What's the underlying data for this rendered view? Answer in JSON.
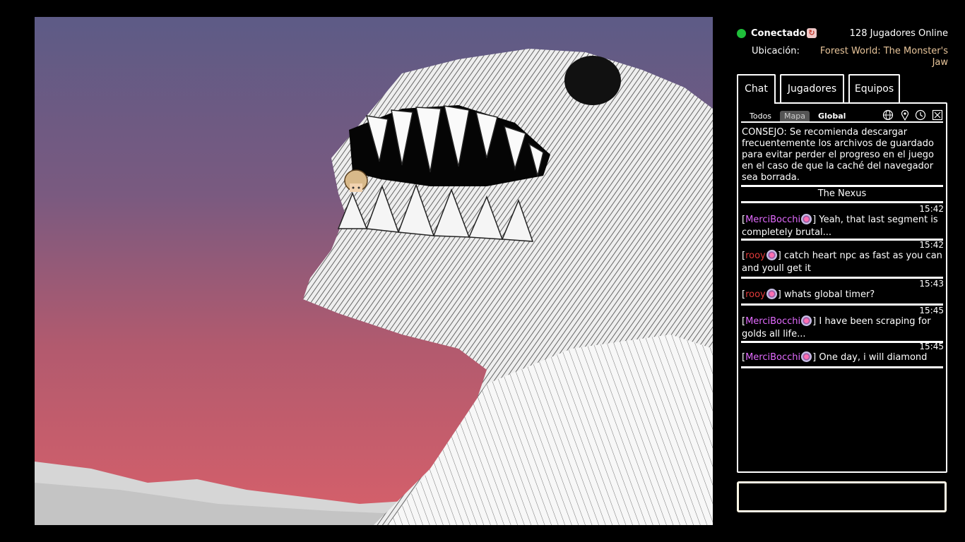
{
  "status": {
    "connected_label": "Conectado",
    "online": "128 Jugadores Online"
  },
  "location": {
    "label": "Ubicación:",
    "value": "Forest World: The Monster's Jaw"
  },
  "tabs": [
    "Chat",
    "Jugadores",
    "Equipos"
  ],
  "filters": [
    "Todos",
    "Mapa",
    "Global"
  ],
  "icons": [
    "globe-icon",
    "pin-icon",
    "clock-icon",
    "close-icon",
    "refresh-icon"
  ],
  "tip": "CONSEJO: Se recomienda descargar frecuentemente los archivos de guardado para evitar perder el progreso en el juego en el caso de que la caché del navegador sea borrada.",
  "channel": "The Nexus",
  "messages": [
    {
      "time": "15:42",
      "name": "MerciBocchi",
      "text": " Yeah, that last segment is completely brutal..."
    },
    {
      "time": "15:42",
      "name": "rooy",
      "text": " catch heart npc as fast as you can and youll get it"
    },
    {
      "time": "15:43",
      "name": "rooy",
      "text": " whats global timer?"
    },
    {
      "time": "15:45",
      "name": "MerciBocchi",
      "text": " I have been scraping for golds all life..."
    },
    {
      "time": "15:45",
      "name": "MerciBocchi",
      "text": " One day, i will diamond"
    }
  ],
  "colors": {
    "connected": "#1fbf3a",
    "location": "#e8c59a",
    "name_pink": "#e36bff",
    "name_red": "#e23b3b"
  }
}
